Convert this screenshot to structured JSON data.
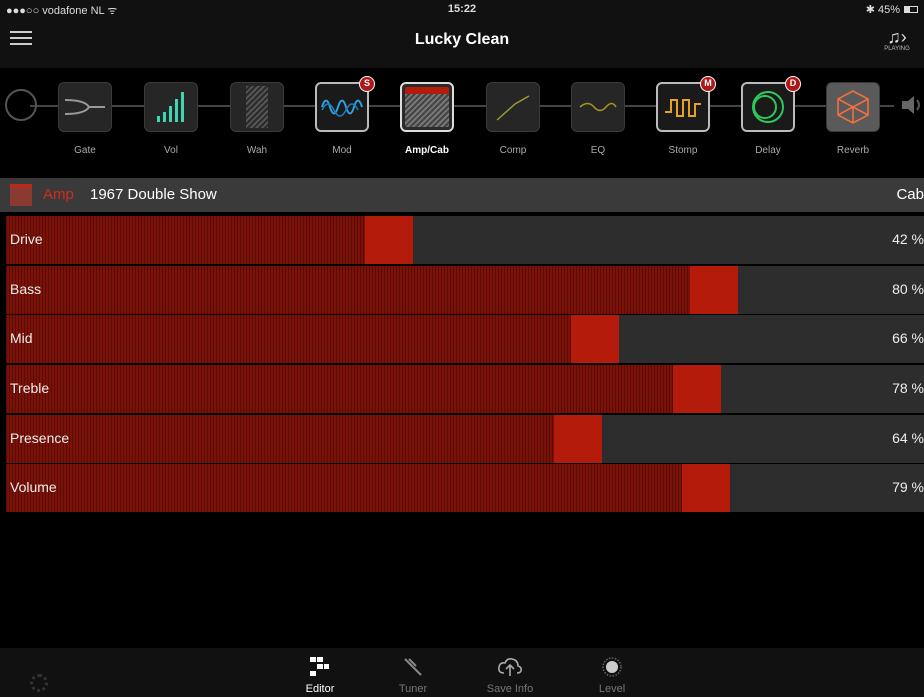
{
  "status": {
    "carrier": "●●●○○ vodafone NL ᯤ",
    "time": "15:22",
    "battery": "✱ 45%"
  },
  "nav": {
    "title": "Lucky Clean",
    "playing_label": "PLAYING"
  },
  "chain": {
    "effects": [
      {
        "label": "Gate",
        "badge": ""
      },
      {
        "label": "Vol",
        "badge": ""
      },
      {
        "label": "Wah",
        "badge": ""
      },
      {
        "label": "Mod",
        "badge": "S"
      },
      {
        "label": "Amp/Cab",
        "badge": ""
      },
      {
        "label": "Comp",
        "badge": ""
      },
      {
        "label": "EQ",
        "badge": ""
      },
      {
        "label": "Stomp",
        "badge": "M"
      },
      {
        "label": "Delay",
        "badge": "D"
      },
      {
        "label": "Reverb",
        "badge": ""
      }
    ]
  },
  "amp": {
    "type_label": "Amp",
    "name": "1967 Double Show",
    "cab_label": "Cab"
  },
  "params": [
    {
      "name": "Drive",
      "value": "42 %",
      "level": 0.42
    },
    {
      "name": "Bass",
      "value": "80 %",
      "level": 0.8
    },
    {
      "name": "Mid",
      "value": "66 %",
      "level": 0.66
    },
    {
      "name": "Treble",
      "value": "78 %",
      "level": 0.78
    },
    {
      "name": "Presence",
      "value": "64 %",
      "level": 0.64
    },
    {
      "name": "Volume",
      "value": "79 %",
      "level": 0.79
    }
  ],
  "tabs": [
    {
      "label": "Editor"
    },
    {
      "label": "Tuner"
    },
    {
      "label": "Save Info"
    },
    {
      "label": "Level"
    }
  ],
  "colors": {
    "accent_red": "#b51b0b",
    "amp_label_red": "#d02b1b"
  }
}
